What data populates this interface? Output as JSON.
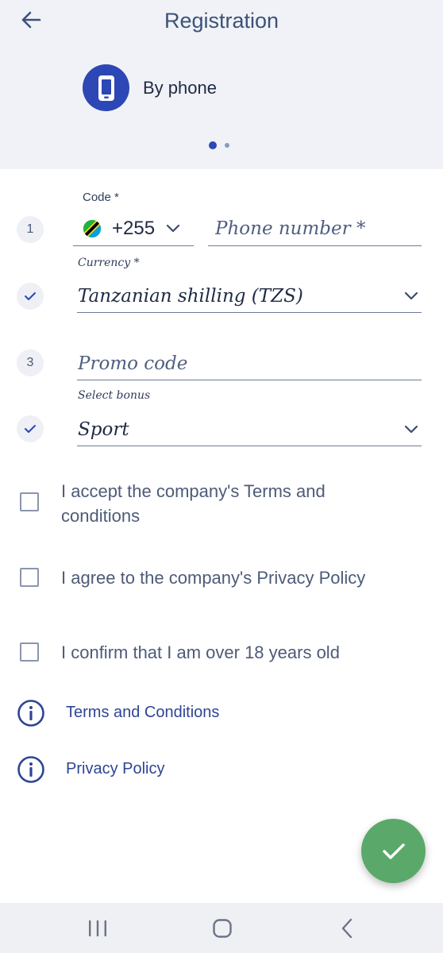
{
  "header": {
    "title": "Registration",
    "back_icon": "arrow-left-icon"
  },
  "method": {
    "label": "By phone",
    "icon": "smartphone-icon",
    "icon_bg": "#2d47b5"
  },
  "pager": {
    "active": 1,
    "total": 2
  },
  "steps": {
    "step1": "1",
    "step3": "3"
  },
  "phone": {
    "code_label": "Code *",
    "code_value": "+255",
    "phone_placeholder": "Phone number *"
  },
  "currency": {
    "label": "Currency *",
    "value": "Tanzanian shilling (TZS)"
  },
  "promo": {
    "placeholder": "Promo code"
  },
  "bonus": {
    "label": "Select bonus",
    "value": "Sport"
  },
  "agreements": [
    "I accept the company's Terms and conditions",
    "I agree to the company's Privacy Policy",
    "I confirm that I am over 18 years old"
  ],
  "links": [
    "Terms and Conditions",
    "Privacy Policy"
  ],
  "colors": {
    "accent": "#2d47b5",
    "submit": "#5aa96a",
    "link": "#2e4596"
  }
}
